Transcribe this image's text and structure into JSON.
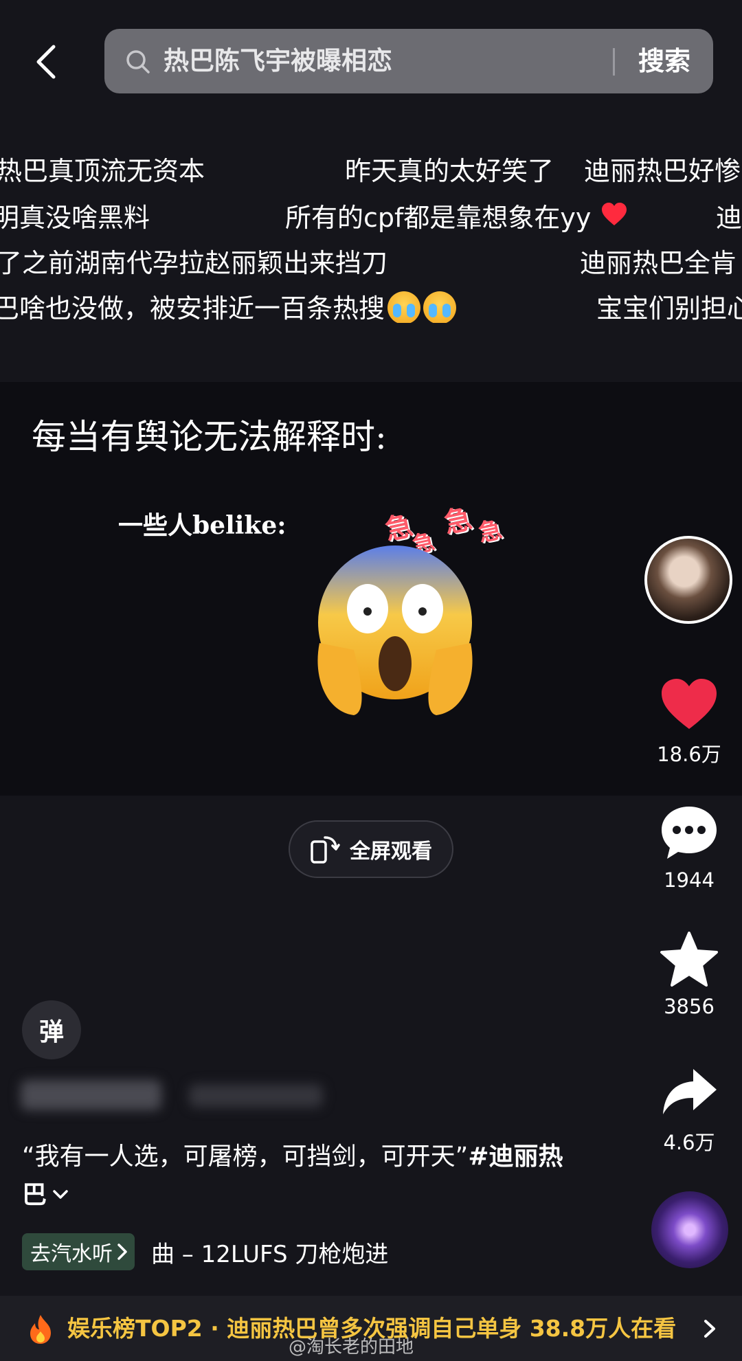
{
  "header": {
    "search_query": "热巴陈飞宇被曝相恋",
    "search_button": "搜索"
  },
  "danmaku": [
    "热巴真顶流无资本",
    "昨天真的太好笑了",
    "迪丽热巴好惨",
    "明真没啥黑料",
    "所有的cpf都是靠想象在yy",
    "迪",
    "了之前湖南代孕拉赵丽颖出来挡刀",
    "迪丽热巴全肯",
    "巴啥也没做，被安排近一百条热搜",
    "宝宝们别担心"
  ],
  "video": {
    "caption": "每当有舆论无法解释时:",
    "subcaption": "一些人belike:",
    "sticker_text": [
      "急",
      "急",
      "急",
      "急"
    ]
  },
  "fullscreen": {
    "label": "全屏观看"
  },
  "actions": {
    "likes": "18.6万",
    "comments": "1944",
    "favorites": "3856",
    "shares": "4.6万"
  },
  "bottom": {
    "danmu_toggle": "弹",
    "description": "“我有一人选，可屠榜，可挡剑，可开天”",
    "hashtag": "#迪丽热巴",
    "qishui_label": "去汽水听",
    "music_title": "曲 – 12LUFS    刀枪炮进"
  },
  "banner": {
    "text": "娱乐榜TOP2 · 迪丽热巴曾多次强调自己单身 38.8万人在看"
  },
  "watermark": "@淘长老的田地",
  "colors": {
    "background": "#15151b",
    "like_red": "#ee2c4a",
    "banner_gold": "#f5c542"
  }
}
